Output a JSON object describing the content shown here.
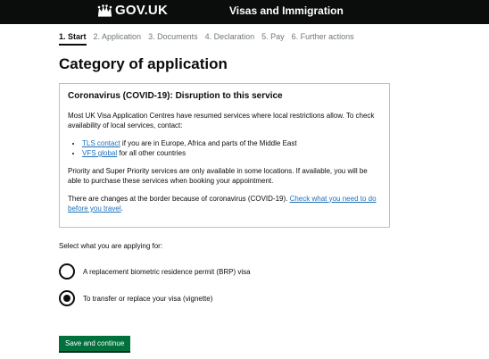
{
  "header": {
    "logo_text": "GOV.UK",
    "service_name": "Visas and Immigration",
    "background_color": "#0b0c0c",
    "logo_icon": "crown-icon"
  },
  "steps": [
    {
      "label": "1. Start",
      "active": true
    },
    {
      "label": "2. Application",
      "active": false
    },
    {
      "label": "3. Documents",
      "active": false
    },
    {
      "label": "4. Declaration",
      "active": false
    },
    {
      "label": "5. Pay",
      "active": false
    },
    {
      "label": "6. Further actions",
      "active": false
    }
  ],
  "page_title": "Category of application",
  "notice": {
    "heading": "Coronavirus (COVID-19): Disruption to this service",
    "para1": "Most UK Visa Application Centres have resumed services where local restrictions allow. To check availability of local services, contact:",
    "items": [
      {
        "link": "TLS contact",
        "text": " if you are in Europe, Africa and parts of the Middle East"
      },
      {
        "link": "VFS global",
        "text": " for all other countries"
      }
    ],
    "para2": "Priority and Super Priority services are only available in some locations. If available, you will be able to purchase these services when booking your appointment.",
    "para3_text": "There are changes at the border because of coronavirus (COVID-19). ",
    "para3_link": "Check what you need to do before you travel",
    "para3_end": ".",
    "link_color": "#1d70b8"
  },
  "question": "Select what you are applying for:",
  "options": [
    {
      "label": "A replacement biometric residence permit (BRP) visa",
      "selected": false
    },
    {
      "label": "To transfer or replace your visa (vignette)",
      "selected": true
    }
  ],
  "submit_label": "Save and continue",
  "submit_color": "#00703c"
}
